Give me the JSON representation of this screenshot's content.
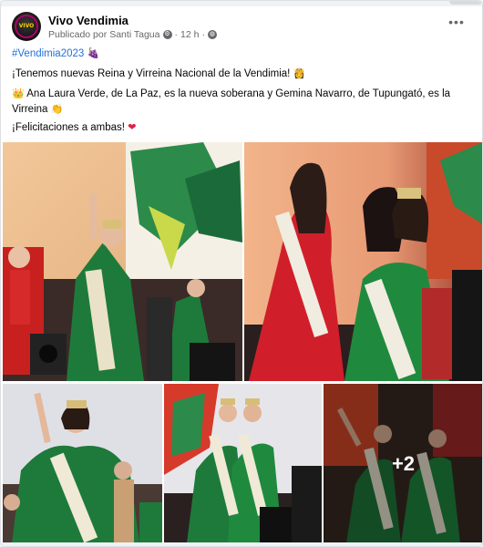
{
  "post": {
    "page_name": "Vivo Vendimia",
    "avatar_text": "VIVO",
    "meta_prefix": "Publicado por",
    "author": "Santi Tagua",
    "time": "12 h",
    "separator": "·",
    "more": "•••",
    "hashtag": "#Vendimia2023",
    "line1": "¡Tenemos nuevas Reina y Virreina Nacional de la Vendimia!",
    "line2": "Ana Laura Verde, de La Paz, es la nueva soberana y Gemina Navarro, de Tupungató, es la Virreina",
    "line3": "¡Felicitaciones a ambas!",
    "extra_photos": "+2"
  },
  "icons": {
    "grapes": "grapes-emoji",
    "crown_person": "crowned-woman-emoji",
    "crown": "crown-emoji",
    "clap": "clapping-hands-emoji",
    "heart": "red-heart-emoji",
    "globe": "globe-icon",
    "verified": "gear-badge-icon"
  },
  "colors": {
    "link": "#216fdb",
    "meta": "#65676b",
    "gown_green": "#1e7a3a",
    "heart": "#e41e3f"
  }
}
